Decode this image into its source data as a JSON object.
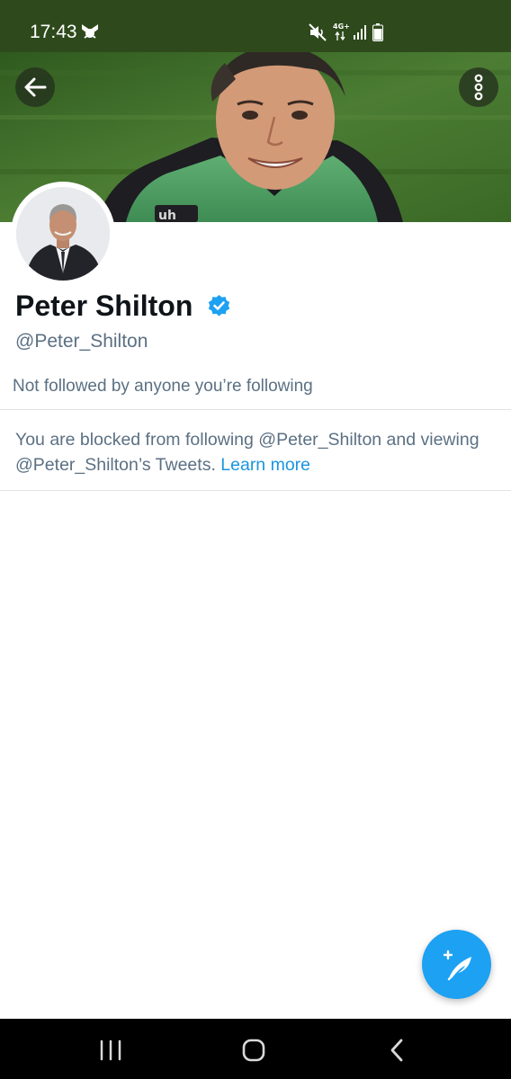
{
  "status_bar": {
    "time": "17:43",
    "network_label": "4G+",
    "icons": [
      "notification-icon",
      "mute-icon",
      "network-arrows-icon",
      "signal-icon",
      "battery-icon"
    ]
  },
  "header": {
    "back_icon": "arrow-left-icon",
    "more_icon": "vertical-dots-icon"
  },
  "profile": {
    "name": "Peter Shilton",
    "verified": true,
    "handle": "@Peter_Shilton",
    "followers_note": "Not followed by anyone you’re following"
  },
  "blocked_notice": {
    "text": "You are blocked from following @Peter_Shilton and viewing @Peter_Shilton’s Tweets. ",
    "link_text": "Learn more"
  },
  "fab": {
    "icon": "compose-tweet-icon"
  },
  "navigation_bar": {
    "icons": [
      "recents-icon",
      "home-icon",
      "back-icon"
    ]
  },
  "colors": {
    "status_bar_bg": "#2e4a1c",
    "link": "#1b95e0",
    "verified_badge": "#1da1f2",
    "fab_bg": "#1da1f2",
    "primary_text": "#0f1419",
    "secondary_text": "#5b7083"
  }
}
